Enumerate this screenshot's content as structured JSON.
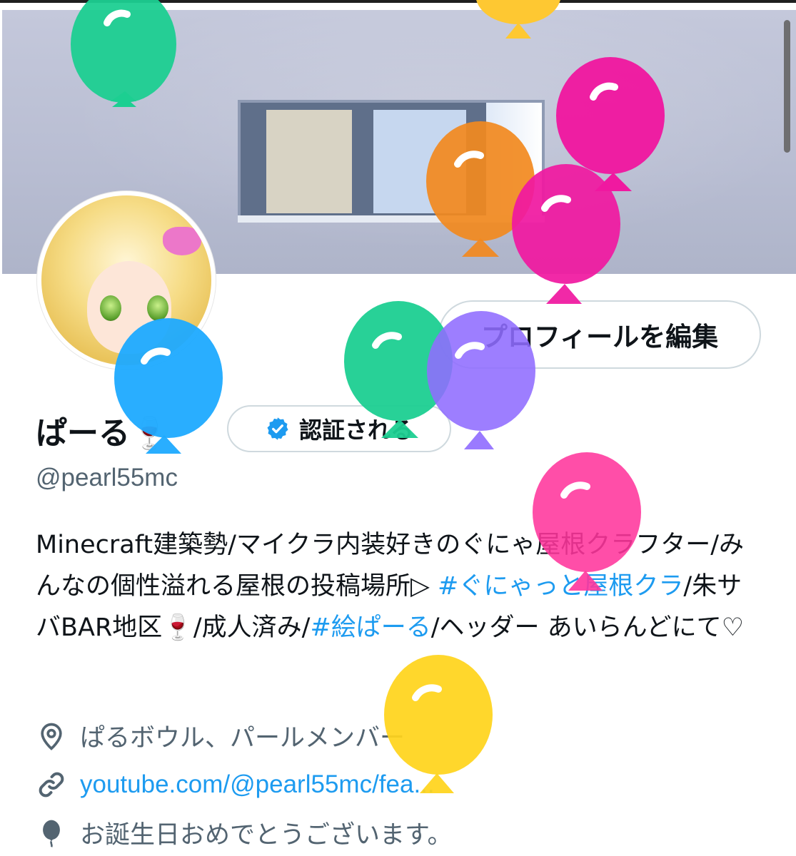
{
  "header": {
    "edit_profile_label": "プロフィールを編集"
  },
  "profile": {
    "display_name": "ぱーる",
    "name_emoji": "🍷",
    "verify_label": "認証される",
    "handle": "@pearl55mc",
    "bio": {
      "segments": [
        {
          "text": "Minecraft建築勢/マイクラ内装好きのぐにゃ屋根クラフター/みんなの個性溢れる屋根の投稿場所▷ ",
          "type": "text"
        },
        {
          "text": "#ぐにゃっと屋根クラ",
          "type": "link"
        },
        {
          "text": "/朱サバBAR地区🍷/成人済み/",
          "type": "text"
        },
        {
          "text": "#絵ぱーる",
          "type": "link"
        },
        {
          "text": "/ヘッダー あいらんどにて♡",
          "type": "text"
        }
      ]
    },
    "location": "ぱるボウル、パールメンバー",
    "website": "youtube.com/@pearl55mc/fea...",
    "birthday": "お誕生日おめでとうございます。"
  },
  "icons": {
    "location": "location-pin-icon",
    "link": "link-icon",
    "birthday": "balloon-icon",
    "verified": "verified-badge-icon"
  },
  "colors": {
    "link": "#1d9bf0",
    "text": "#0f1419",
    "secondary": "#536471",
    "border": "#cfd9de",
    "balloons": [
      "#1ccf91",
      "#fec832",
      "#f019a0",
      "#f2891e",
      "#ff359c",
      "#1eaaff",
      "#8f6cff",
      "#ffd41c"
    ]
  }
}
